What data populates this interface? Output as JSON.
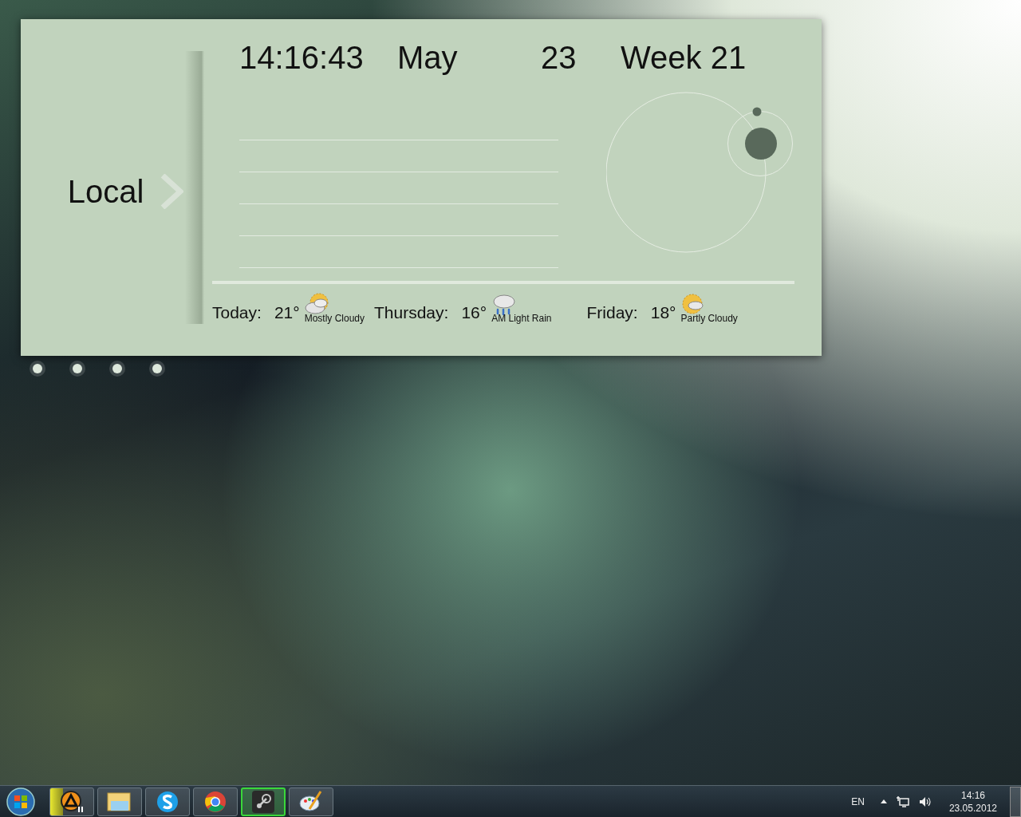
{
  "widget": {
    "location": "Local",
    "time": "14:16:43",
    "month": "May",
    "day": "23",
    "week": "Week 21",
    "forecast": [
      {
        "day": "Today:",
        "temp": "21°",
        "condition": "Mostly Cloudy",
        "kind": "mostly_cloudy"
      },
      {
        "day": "Thursday:",
        "temp": "16°",
        "condition": "AM Light Rain",
        "kind": "rain"
      },
      {
        "day": "Friday:",
        "temp": "18°",
        "condition": "Partly Cloudy",
        "kind": "partly_cloudy"
      }
    ]
  },
  "pages": [
    {
      "selected": false
    },
    {
      "selected": false
    },
    {
      "selected": false
    },
    {
      "selected": false
    }
  ],
  "taskbar": {
    "apps": [
      {
        "kind": "player",
        "selected": false,
        "level": 0.3
      },
      {
        "kind": "folder",
        "selected": false
      },
      {
        "kind": "chat",
        "selected": false
      },
      {
        "kind": "browser",
        "selected": false
      },
      {
        "kind": "game",
        "selected": true
      },
      {
        "kind": "paint",
        "selected": false
      }
    ],
    "language": "EN",
    "clock_time": "14:16",
    "clock_date": "23.05.2012"
  }
}
